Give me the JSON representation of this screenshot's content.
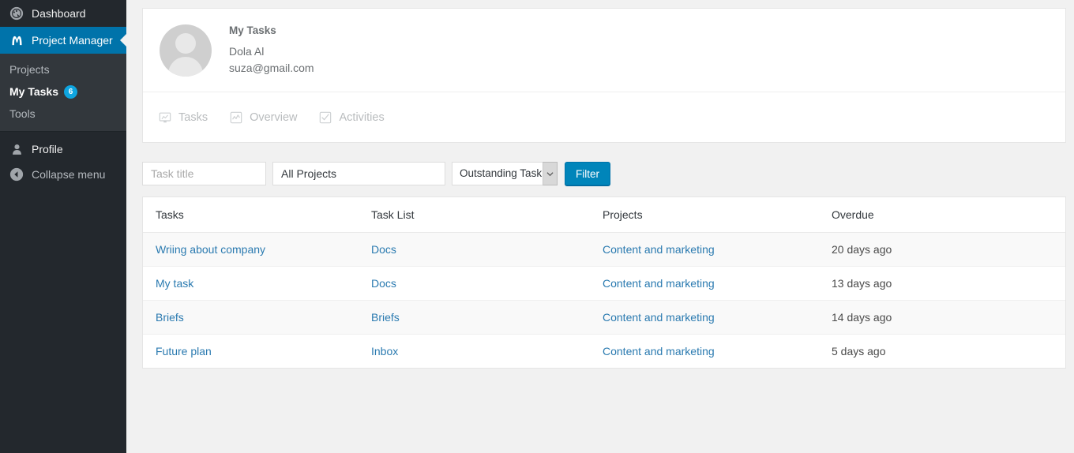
{
  "sidebar": {
    "dashboard": {
      "label": "Dashboard",
      "icon": "dashboard-icon"
    },
    "project_manager": {
      "label": "Project Manager",
      "icon": "project-manager-icon"
    },
    "submenu": [
      {
        "label": "Projects",
        "current": false
      },
      {
        "label": "My Tasks",
        "current": true,
        "badge": "6"
      },
      {
        "label": "Tools",
        "current": false
      }
    ],
    "profile": {
      "label": "Profile",
      "icon": "user-icon"
    },
    "collapse": {
      "label": "Collapse menu",
      "icon": "collapse-arrow-icon"
    },
    "colors": {
      "background": "#23282d",
      "submenu_background": "#32373c",
      "active": "#0073aa",
      "badge": "#0ea5e0"
    }
  },
  "profile_card": {
    "title": "My Tasks",
    "name": "Dola Al",
    "email": "suza@gmail.com",
    "avatar": "default-avatar"
  },
  "tabs": [
    {
      "label": "Tasks",
      "icon": "tasks-monitor-icon"
    },
    {
      "label": "Overview",
      "icon": "overview-chart-icon"
    },
    {
      "label": "Activities",
      "icon": "activities-checkbox-icon"
    }
  ],
  "filter": {
    "task_title_placeholder": "Task title",
    "task_title_value": "",
    "project_value": "All Projects",
    "status_value": "Outstanding Task",
    "status_options": [
      "Outstanding Task"
    ],
    "button_label": "Filter",
    "button_color": "#0085ba"
  },
  "table": {
    "columns": [
      "Tasks",
      "Task List",
      "Projects",
      "Overdue"
    ],
    "rows": [
      {
        "task": "Wriing about company",
        "task_list": "Docs",
        "project": "Content and marketing",
        "overdue": "20 days ago"
      },
      {
        "task": "My task",
        "task_list": "Docs",
        "project": "Content and marketing",
        "overdue": "13 days ago"
      },
      {
        "task": "Briefs",
        "task_list": "Briefs",
        "project": "Content and marketing",
        "overdue": "14 days ago"
      },
      {
        "task": "Future plan",
        "task_list": "Inbox",
        "project": "Content and marketing",
        "overdue": "5 days ago"
      }
    ],
    "link_color": "#2a7ab0"
  }
}
